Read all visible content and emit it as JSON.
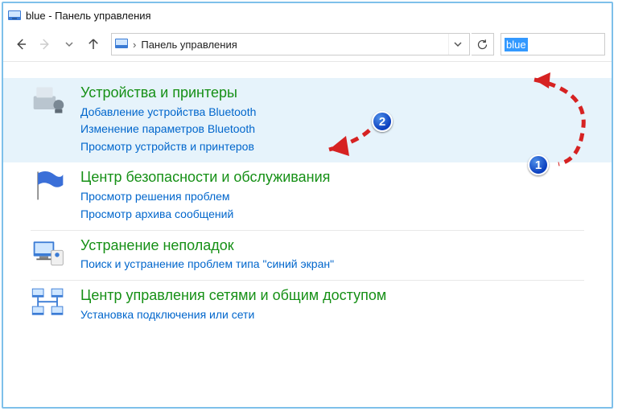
{
  "title": "blue - Панель управления",
  "address": {
    "location": "Панель управления"
  },
  "search": {
    "value": "blue"
  },
  "items": [
    {
      "heading": "Устройства и принтеры",
      "links": [
        "Добавление устройства Bluetooth",
        "Изменение параметров Bluetooth",
        "Просмотр устройств и принтеров"
      ]
    },
    {
      "heading": "Центр безопасности и обслуживания",
      "links": [
        "Просмотр решения проблем",
        "Просмотр архива сообщений"
      ]
    },
    {
      "heading": "Устранение неполадок",
      "links": [
        "Поиск и устранение проблем типа \"синий экран\""
      ]
    },
    {
      "heading": "Центр управления сетями и общим доступом",
      "links": [
        "Установка подключения или сети"
      ]
    }
  ],
  "badges": {
    "one": "1",
    "two": "2"
  }
}
